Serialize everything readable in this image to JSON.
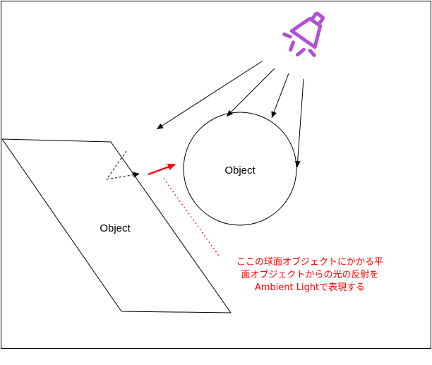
{
  "diagram": {
    "plane_object_label": "Object",
    "sphere_object_label": "Object",
    "annotation": {
      "line1": "ここの球面オブジェクトにかかる平",
      "line2": "面オブジェクトからの光の反射を",
      "line3": "Ambient Lightで表現する"
    },
    "icons": {
      "light": "spotlight-icon"
    },
    "colors": {
      "light_icon": "#b14fd6",
      "highlight": "#ff0000",
      "stroke": "#000000",
      "background": "#ffffff"
    }
  }
}
